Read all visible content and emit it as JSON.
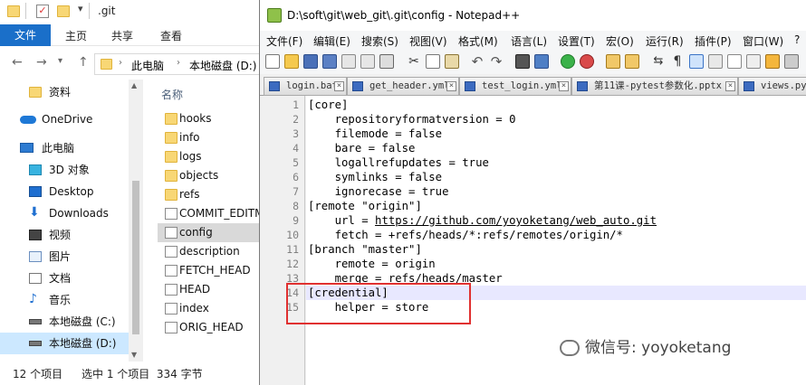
{
  "explorer": {
    "title": ".git",
    "ribbon": {
      "file": "文件",
      "tabs": [
        "主页",
        "共享",
        "查看"
      ]
    },
    "breadcrumb": [
      "此电脑",
      "本地磁盘 (D:)"
    ],
    "nav": [
      {
        "label": "资料",
        "icon": "folder-icon"
      },
      {
        "label": "OneDrive",
        "icon": "cloud-icon"
      },
      {
        "label": "此电脑",
        "icon": "computer-icon"
      },
      {
        "label": "3D 对象",
        "icon": "cube-icon"
      },
      {
        "label": "Desktop",
        "icon": "desktop-icon"
      },
      {
        "label": "Downloads",
        "icon": "download-icon"
      },
      {
        "label": "视频",
        "icon": "video-icon"
      },
      {
        "label": "图片",
        "icon": "picture-icon"
      },
      {
        "label": "文档",
        "icon": "document-icon"
      },
      {
        "label": "音乐",
        "icon": "music-icon"
      },
      {
        "label": "本地磁盘 (C:)",
        "icon": "drive-icon"
      },
      {
        "label": "本地磁盘 (D:)",
        "icon": "drive-icon"
      }
    ],
    "column_header": "名称",
    "files": [
      {
        "name": "hooks",
        "type": "folder"
      },
      {
        "name": "info",
        "type": "folder"
      },
      {
        "name": "logs",
        "type": "folder"
      },
      {
        "name": "objects",
        "type": "folder"
      },
      {
        "name": "refs",
        "type": "folder"
      },
      {
        "name": "COMMIT_EDITMSG",
        "type": "file"
      },
      {
        "name": "config",
        "type": "file"
      },
      {
        "name": "description",
        "type": "file"
      },
      {
        "name": "FETCH_HEAD",
        "type": "file"
      },
      {
        "name": "HEAD",
        "type": "file"
      },
      {
        "name": "index",
        "type": "file"
      },
      {
        "name": "ORIG_HEAD",
        "type": "file"
      }
    ],
    "status": {
      "count": "12 个项目",
      "selected": "选中 1 个项目  334 字节"
    }
  },
  "notepad": {
    "title": "D:\\soft\\git\\web_git\\.git\\config - Notepad++",
    "menu": [
      "文件(F)",
      "编辑(E)",
      "搜索(S)",
      "视图(V)",
      "格式(M)",
      "语言(L)",
      "设置(T)",
      "宏(O)",
      "运行(R)",
      "插件(P)",
      "窗口(W)",
      "?"
    ],
    "tabs": [
      "login.bat",
      "get_header.yml",
      "test_login.yml",
      "第11课-pytest参数化.pptx",
      "views.py"
    ],
    "lines": [
      "[core]",
      "    repositoryformatversion = 0",
      "    filemode = false",
      "    bare = false",
      "    logallrefupdates = true",
      "    symlinks = false",
      "    ignorecase = true",
      "[remote \"origin\"]",
      "    url = ",
      "    fetch = +refs/heads/*:refs/remotes/origin/*",
      "[branch \"master\"]",
      "    remote = origin",
      "    merge = refs/heads/master",
      "[credential]",
      "    helper = store"
    ],
    "url_text": "https://github.com/yoyoketang/web_auto.git",
    "line_numbers": [
      "1",
      "2",
      "3",
      "4",
      "5",
      "6",
      "7",
      "8",
      "9",
      "10",
      "11",
      "12",
      "13",
      "14",
      "15"
    ]
  },
  "watermark": "微信号: yoyoketang",
  "colors": {
    "accent": "#1a6fc9",
    "highlight_box": "#e03030"
  }
}
